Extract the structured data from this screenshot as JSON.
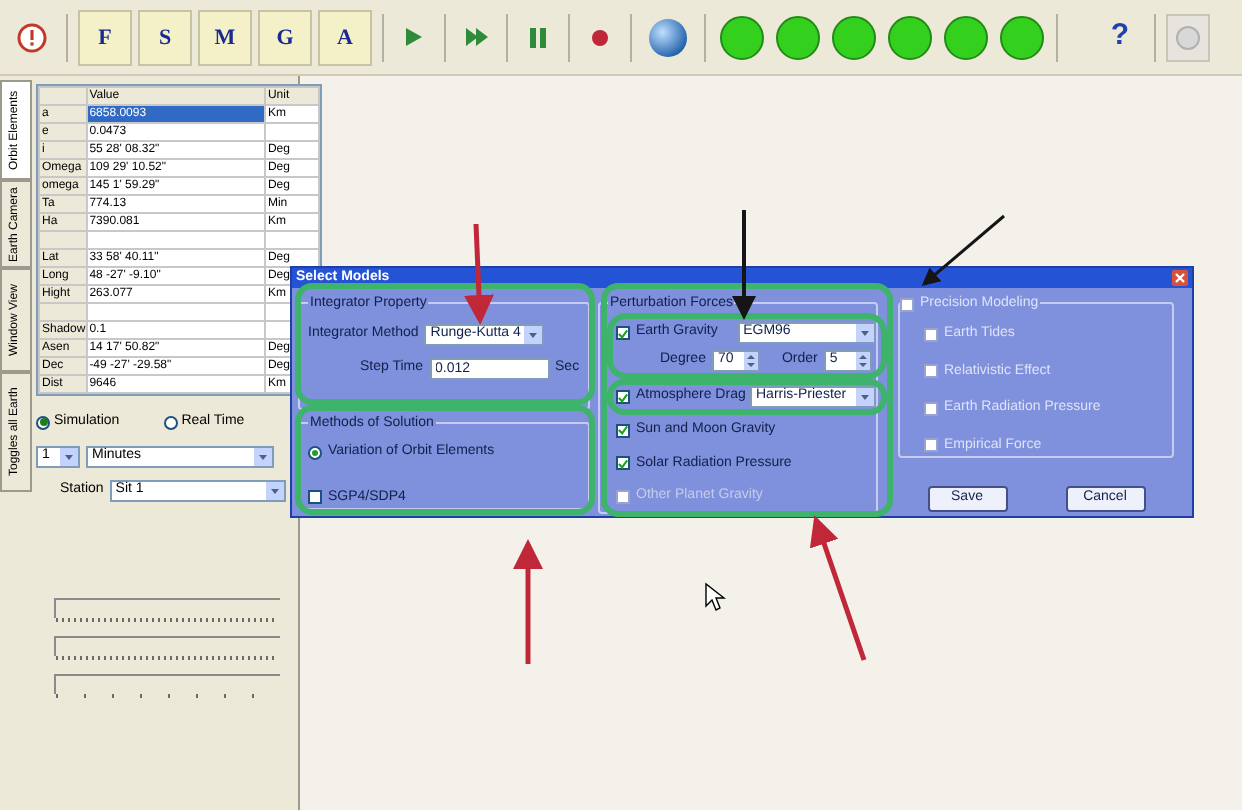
{
  "toolbar": {
    "buttons": [
      {
        "kind": "alert"
      },
      {
        "kind": "letter",
        "label": "F"
      },
      {
        "kind": "letter",
        "label": "S"
      },
      {
        "kind": "letter",
        "label": "M"
      },
      {
        "kind": "letter",
        "label": "G"
      },
      {
        "kind": "letter",
        "label": "A"
      },
      {
        "kind": "play"
      },
      {
        "kind": "step"
      },
      {
        "kind": "pause"
      },
      {
        "kind": "record"
      },
      {
        "kind": "globe"
      },
      {
        "kind": "lamp"
      },
      {
        "kind": "lamp"
      },
      {
        "kind": "lamp"
      },
      {
        "kind": "lamp"
      },
      {
        "kind": "lamp"
      },
      {
        "kind": "lamp"
      },
      {
        "kind": "help",
        "label": "?"
      },
      {
        "kind": "disabled"
      }
    ]
  },
  "side_tabs": [
    {
      "label": "Orbit Elements",
      "selected": true
    },
    {
      "label": "Earth Camera",
      "selected": false
    },
    {
      "label": "Window View",
      "selected": false
    },
    {
      "label": "Toggles all Earth",
      "selected": false
    }
  ],
  "table": {
    "columns": [
      "Value",
      "Unit"
    ],
    "rows": [
      {
        "kind": "data",
        "name": "a",
        "value": "6858.0093",
        "unit": "Km",
        "selected": true
      },
      {
        "kind": "data",
        "name": "e",
        "value": "0.0473",
        "selected": false
      },
      {
        "kind": "data",
        "name": "i",
        "value": "55 28' 08.32\"",
        "unit": "Deg",
        "selected": false
      },
      {
        "kind": "data",
        "name": "Omega",
        "value": "109 29' 10.52\"",
        "unit": "Deg",
        "selected": false
      },
      {
        "kind": "data",
        "name": "omega",
        "value": "145 1' 59.29\"",
        "unit": "Deg",
        "selected": false
      },
      {
        "kind": "data",
        "name": "Ta",
        "value": "774.13",
        "unit": "Min",
        "selected": false
      },
      {
        "kind": "data",
        "name": "Ha",
        "value": "7390.081",
        "unit": "Km",
        "selected": false
      },
      {
        "kind": "blank"
      },
      {
        "kind": "data",
        "name": "Lat",
        "value": "33 58' 40.11\"",
        "unit": "Deg",
        "selected": false
      },
      {
        "kind": "data",
        "name": "Long",
        "value": "48 -27' -9.10\"",
        "unit": "Deg",
        "selected": false
      },
      {
        "kind": "data",
        "name": "Hight",
        "value": "263.077",
        "unit": "Km",
        "selected": false
      },
      {
        "kind": "blank"
      },
      {
        "kind": "data",
        "name": "Shadow",
        "value": "0.1",
        "selected": false
      },
      {
        "kind": "data",
        "name": "Asen",
        "value": "14 17' 50.82\"",
        "unit": "Deg",
        "selected": false
      },
      {
        "kind": "data",
        "name": "Dec",
        "value": "-49 -27' -29.58\"",
        "unit": "Deg",
        "selected": false
      },
      {
        "kind": "data",
        "name": "Dist",
        "value": "9646",
        "unit": "Km",
        "selected": false
      }
    ]
  },
  "time_mode": [
    {
      "label": "Simulation",
      "selected": true
    },
    {
      "label": "Real Time",
      "selected": false
    }
  ],
  "step": {
    "count": "1",
    "unit": "Minutes"
  },
  "station": {
    "label": "Station",
    "value": "Sit 1"
  },
  "dialog": {
    "title": "Select Models",
    "integrator": {
      "title": "Integrator Property",
      "method_label": "Integrator Method",
      "method": "Runge-Kutta 4",
      "step_label": "Step Time",
      "step": "0.012",
      "step_unit": "Sec"
    },
    "solution": {
      "title": "Methods of Solution",
      "options": [
        {
          "kind": "radio",
          "label": "Variation of Orbit Elements",
          "selected": true
        },
        {
          "kind": "check",
          "label": "SGP4/SDP4",
          "selected": false
        }
      ]
    },
    "perturbation": {
      "title": "Perturbation Forces",
      "gravity": {
        "label": "Earth Gravity",
        "checked": true,
        "model": "EGM96",
        "degree_label": "Degree",
        "degree": "70",
        "order_label": "Order",
        "order": "5"
      },
      "drag": {
        "label": "Atmosphere Drag",
        "checked": true,
        "model": "Harris-Priester"
      },
      "others": [
        {
          "label": "Sun and Moon Gravity",
          "checked": true
        },
        {
          "label": "Solar Radiation Pressure",
          "checked": true
        },
        {
          "label": "Other Planet Gravity",
          "checked": false
        }
      ]
    },
    "precision": {
      "label": "Precision Modeling",
      "checked": false,
      "items": [
        {
          "label": "Earth Tides",
          "checked": false
        },
        {
          "label": "Relativistic Effect",
          "checked": false
        },
        {
          "label": "Earth Radiation Pressure",
          "checked": false
        },
        {
          "label": "Empirical Force",
          "checked": false
        }
      ]
    },
    "buttons": [
      "Save",
      "Cancel"
    ]
  }
}
